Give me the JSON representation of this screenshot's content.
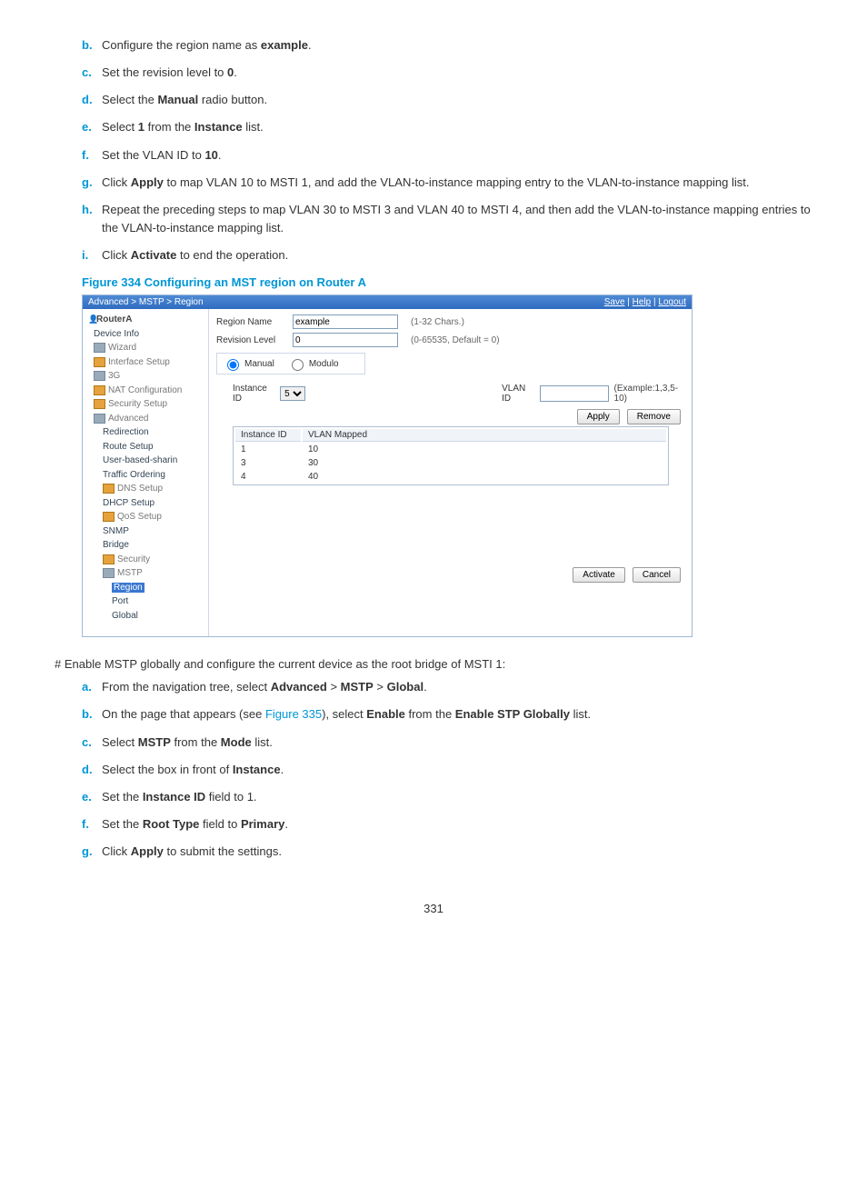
{
  "steps1": {
    "b": [
      "Configure the region name as ",
      "example",
      "."
    ],
    "c": [
      "Set the revision level to ",
      "0",
      "."
    ],
    "d": [
      "Select the ",
      "Manual",
      " radio button."
    ],
    "e": [
      "Select ",
      "1",
      " from the ",
      "Instance",
      " list."
    ],
    "f": [
      "Set the VLAN ID to ",
      "10",
      "."
    ],
    "g": [
      "Click ",
      "Apply",
      " to map VLAN 10 to MSTI 1, and add the VLAN-to-instance mapping entry to the VLAN-to-instance mapping list."
    ],
    "h": "Repeat the preceding steps to map VLAN 30 to MSTI 3 and VLAN 40 to MSTI 4, and then add the VLAN-to-instance mapping entries to the VLAN-to-instance mapping list.",
    "i": [
      "Click ",
      "Activate",
      " to end the operation."
    ]
  },
  "figure_caption": "Figure 334 Configuring an MST region on Router A",
  "ui": {
    "breadcrumb": "Advanced > MSTP > Region",
    "top_links": {
      "save": "Save",
      "help": "Help",
      "logout": "Logout"
    },
    "tree": {
      "root": "RouterA",
      "items": [
        {
          "label": "Device Info",
          "type": "leaf"
        },
        {
          "label": "Wizard",
          "type": "folder-g"
        },
        {
          "label": "Interface Setup",
          "type": "folder"
        },
        {
          "label": "3G",
          "type": "folder-g"
        },
        {
          "label": "NAT Configuration",
          "type": "folder"
        },
        {
          "label": "Security Setup",
          "type": "folder"
        },
        {
          "label": "Advanced",
          "type": "folder-g"
        },
        {
          "label": "Redirection",
          "type": "leaf",
          "indent": 1
        },
        {
          "label": "Route Setup",
          "type": "leaf",
          "indent": 1
        },
        {
          "label": "User-based-sharin",
          "type": "leaf",
          "indent": 1
        },
        {
          "label": "Traffic Ordering",
          "type": "leaf",
          "indent": 1
        },
        {
          "label": "DNS Setup",
          "type": "folder",
          "indent": 1
        },
        {
          "label": "DHCP Setup",
          "type": "leaf",
          "indent": 1
        },
        {
          "label": "QoS Setup",
          "type": "folder",
          "indent": 1
        },
        {
          "label": "SNMP",
          "type": "leaf",
          "indent": 1
        },
        {
          "label": "Bridge",
          "type": "leaf",
          "indent": 1
        },
        {
          "label": "Security",
          "type": "folder",
          "indent": 1
        },
        {
          "label": "MSTP",
          "type": "folder-g",
          "indent": 1
        },
        {
          "label": "Region",
          "type": "leaf",
          "indent": 2,
          "sel": true
        },
        {
          "label": "Port",
          "type": "leaf",
          "indent": 2
        },
        {
          "label": "Global",
          "type": "leaf",
          "indent": 2
        }
      ]
    },
    "form": {
      "region_name_label": "Region Name",
      "region_name_value": "example",
      "region_name_hint": "(1-32 Chars.)",
      "revision_label": "Revision Level",
      "revision_value": "0",
      "revision_hint": "(0-65535, Default = 0)",
      "mode_manual": "Manual",
      "mode_modulo": "Modulo",
      "instance_id_label": "Instance ID",
      "instance_id_value": "5",
      "vlan_id_label": "VLAN ID",
      "vlan_id_value": "",
      "example_hint": "(Example:1,3,5-10)",
      "apply_btn": "Apply",
      "remove_btn": "Remove",
      "table_col_id": "Instance ID",
      "table_col_vlan": "VLAN Mapped",
      "rows": [
        {
          "id": "1",
          "vlan": "10"
        },
        {
          "id": "3",
          "vlan": "30"
        },
        {
          "id": "4",
          "vlan": "40"
        }
      ],
      "activate_btn": "Activate",
      "cancel_btn": "Cancel"
    }
  },
  "section2_heading": "# Enable MSTP globally and configure the current device as the root bridge of MSTI 1:",
  "steps2": {
    "a": [
      "From the navigation tree, select ",
      "Advanced",
      " > ",
      "MSTP",
      " > ",
      "Global",
      "."
    ],
    "b_pre": "On the page that appears (see ",
    "b_link": "Figure 335",
    "b_mid": "), select ",
    "b_b1": "Enable",
    "b_mid2": " from the ",
    "b_b2": "Enable STP Globally",
    "b_post": " list.",
    "c": [
      "Select ",
      "MSTP",
      " from the ",
      "Mode",
      " list."
    ],
    "d": [
      "Select the box in front of ",
      "Instance",
      "."
    ],
    "e": [
      "Set the ",
      "Instance ID",
      " field to 1."
    ],
    "f": [
      "Set the ",
      "Root Type",
      " field to ",
      "Primary",
      "."
    ],
    "g": [
      "Click ",
      "Apply",
      " to submit the settings."
    ]
  },
  "page_number": "331"
}
